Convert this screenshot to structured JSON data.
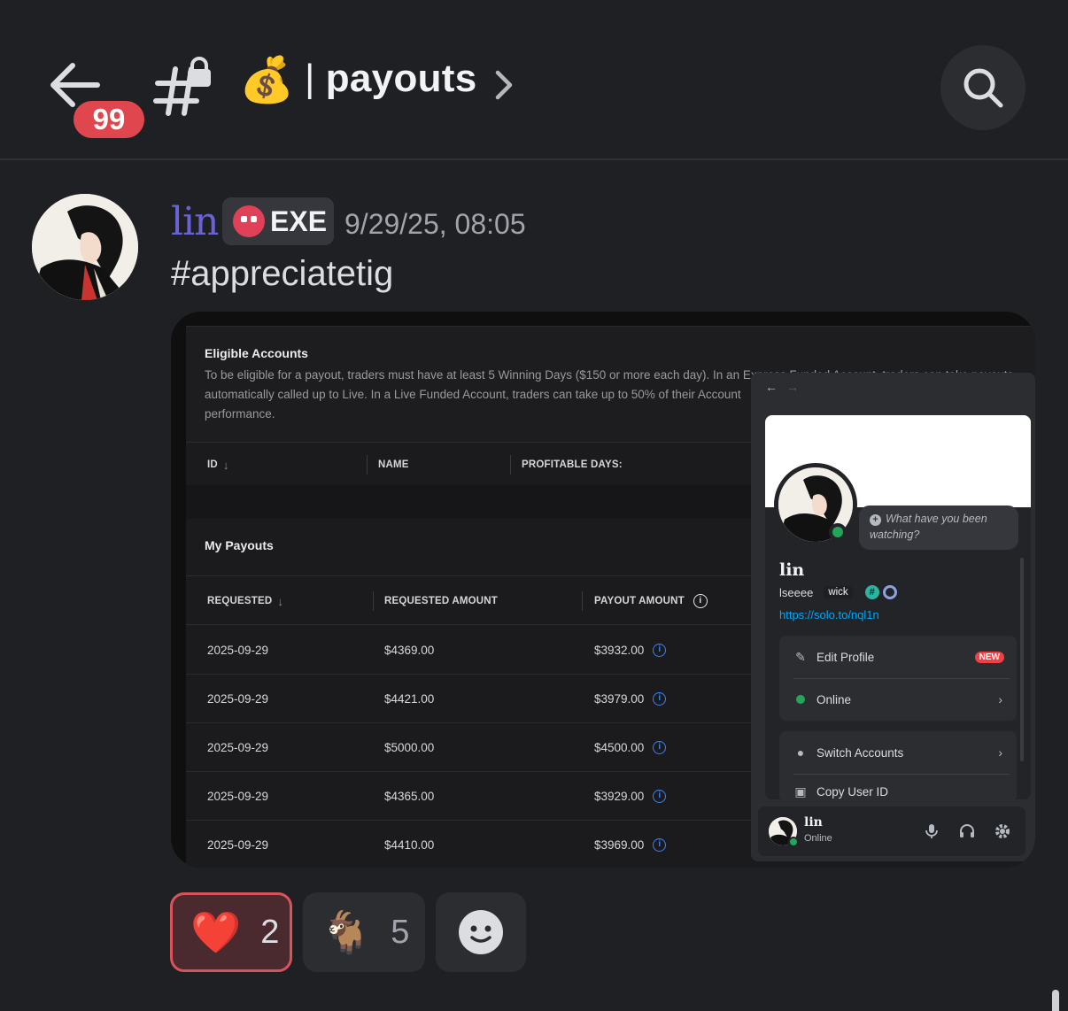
{
  "header": {
    "unread_badge": "99",
    "channel_emoji": "💰",
    "channel_separator": "|",
    "channel_name": "payouts"
  },
  "message": {
    "author": "lin",
    "tag": "EXE",
    "timestamp": "9/29/25, 08:05",
    "text": "#appreciatetig"
  },
  "screenshot": {
    "eligible": {
      "title": "Eligible Accounts",
      "desc_line1": "To be eligible for a payout, traders must have at least 5 Winning Days ($150 or more each day). In an Express Funded Account, traders can take payouts",
      "desc_line2": "automatically called up to Live. In a Live Funded Account, traders can take up to 50% of their Account",
      "desc_line3": "performance.",
      "columns": [
        "ID",
        "NAME",
        "PROFITABLE DAYS:"
      ]
    },
    "payouts": {
      "title": "My Payouts",
      "columns": [
        "REQUESTED",
        "REQUESTED AMOUNT",
        "PAYOUT AMOUNT"
      ],
      "rows": [
        {
          "date": "2025-09-29",
          "requested": "$4369.00",
          "payout": "$3932.00"
        },
        {
          "date": "2025-09-29",
          "requested": "$4421.00",
          "payout": "$3979.00"
        },
        {
          "date": "2025-09-29",
          "requested": "$5000.00",
          "payout": "$4500.00"
        },
        {
          "date": "2025-09-29",
          "requested": "$4365.00",
          "payout": "$3929.00"
        },
        {
          "date": "2025-09-29",
          "requested": "$4410.00",
          "payout": "$3969.00"
        }
      ]
    },
    "profile": {
      "status_prompt_1": "What have you been",
      "status_prompt_2": "watching?",
      "name": "lin",
      "handle": "lseeee",
      "chip": "wick",
      "hash_badge": "#",
      "link": "https://solo.to/nql1n",
      "menu": {
        "edit_profile": "Edit Profile",
        "new_badge": "NEW",
        "online": "Online",
        "switch_accounts": "Switch Accounts",
        "copy_user_id": "Copy User ID"
      },
      "userbar": {
        "name": "lin",
        "status": "Online"
      }
    }
  },
  "reactions": [
    {
      "emoji": "❤️",
      "count": "2",
      "active": true
    },
    {
      "emoji": "🐐",
      "count": "5",
      "active": false
    }
  ],
  "colors": {
    "background": "#1f2023",
    "badge_red": "#e0464e",
    "author_color": "#6a63d6",
    "online_green": "#23a55a",
    "link_blue": "#00a8fc"
  }
}
